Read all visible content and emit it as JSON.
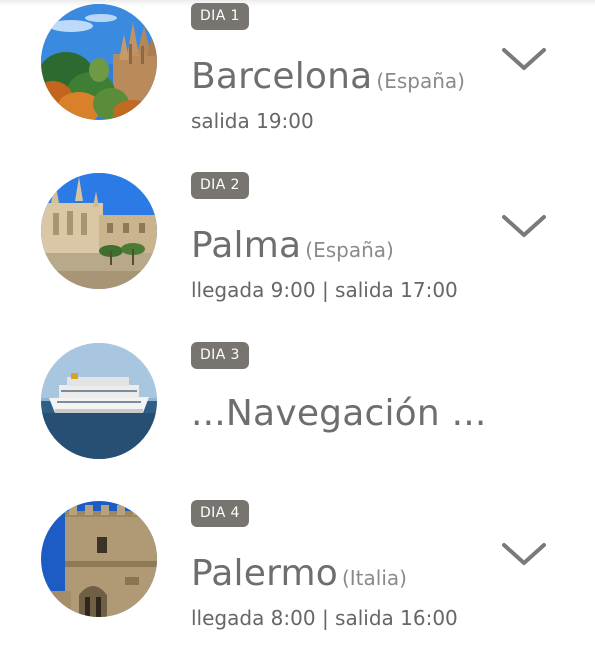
{
  "itinerary": {
    "days": [
      {
        "badge": "DIA 1",
        "city": "Barcelona",
        "country": "(España)",
        "times": "salida 19:00",
        "photo": "barcelona-photo",
        "expand_icon": "chevron-down-icon"
      },
      {
        "badge": "DIA 2",
        "city": "Palma",
        "country": "(España)",
        "times": "llegada 9:00 | salida 17:00",
        "photo": "palma-photo",
        "expand_icon": "chevron-down-icon"
      },
      {
        "badge": "DIA 3",
        "city": "...Navegación ...",
        "photo": "cruise-ship-photo"
      },
      {
        "badge": "DIA 4",
        "city": "Palermo",
        "country": "(Italia)",
        "times": "llegada 8:00 | salida 16:00",
        "photo": "palermo-photo",
        "expand_icon": "chevron-down-icon"
      }
    ]
  },
  "colors": {
    "badge_bg": "#78746f",
    "text": "#6e6e6e",
    "chevron": "#7a7a7a"
  }
}
